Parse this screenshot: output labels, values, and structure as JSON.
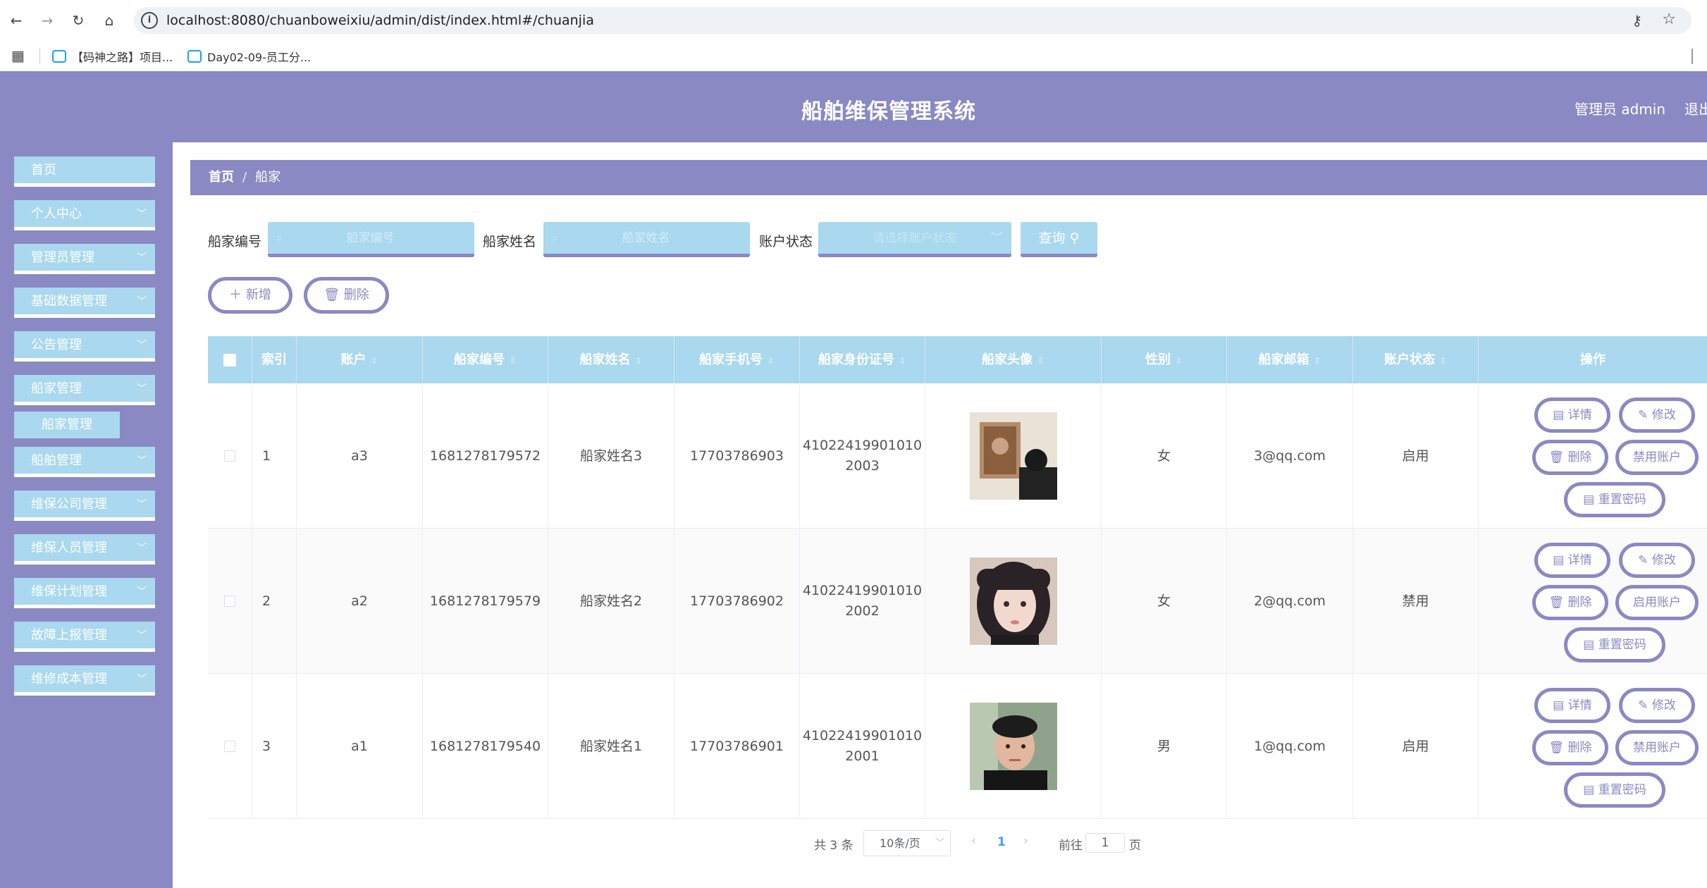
{
  "browser": {
    "url": "localhost:8080/chuanboweixiu/admin/dist/index.html#/chuanjia",
    "bookmarks": [
      "【码神之路】项目...",
      "Day02-09-员工分..."
    ]
  },
  "header": {
    "title": "船舶维保管理系统",
    "user": "管理员 admin",
    "logout": "退出"
  },
  "sidebar": {
    "items": [
      {
        "label": "首页"
      },
      {
        "label": "个人中心"
      },
      {
        "label": "管理员管理"
      },
      {
        "label": "基础数据管理"
      },
      {
        "label": "公告管理"
      },
      {
        "label": "船家管理"
      },
      {
        "label": "船舶管理"
      },
      {
        "label": "维保公司管理"
      },
      {
        "label": "维保人员管理"
      },
      {
        "label": "维保计划管理"
      },
      {
        "label": "故障上报管理"
      },
      {
        "label": "维修成本管理"
      }
    ],
    "sub_item": "船家管理"
  },
  "breadcrumb": {
    "home": "首页",
    "current": "船家"
  },
  "search": {
    "field1_label": "船家编号",
    "field1_placeholder": "船家编号",
    "field2_label": "船家姓名",
    "field2_placeholder": "船家姓名",
    "field3_label": "账户状态",
    "field3_placeholder": "请选择账户状态",
    "query": "查询"
  },
  "actions": {
    "add": "新增",
    "delete": "删除"
  },
  "table": {
    "headers": [
      "索引",
      "账户",
      "船家编号",
      "船家姓名",
      "船家手机号",
      "船家身份证号",
      "船家头像",
      "性别",
      "船家邮箱",
      "账户状态",
      "操作"
    ],
    "rows": [
      {
        "index": "1",
        "account": "a3",
        "code": "1681278179572",
        "name": "船家姓名3",
        "phone": "17703786903",
        "id_line1": "41022419901010",
        "id_line2": "2003",
        "gender": "女",
        "email": "3@qq.com",
        "status": "启用",
        "toggle": "禁用账户"
      },
      {
        "index": "2",
        "account": "a2",
        "code": "1681278179579",
        "name": "船家姓名2",
        "phone": "17703786902",
        "id_line1": "41022419901010",
        "id_line2": "2002",
        "gender": "女",
        "email": "2@qq.com",
        "status": "禁用",
        "toggle": "启用账户"
      },
      {
        "index": "3",
        "account": "a1",
        "code": "1681278179540",
        "name": "船家姓名1",
        "phone": "17703786901",
        "id_line1": "41022419901010",
        "id_line2": "2001",
        "gender": "男",
        "email": "1@qq.com",
        "status": "启用",
        "toggle": "禁用账户"
      }
    ],
    "op_labels": {
      "detail": "详情",
      "edit": "修改",
      "delete": "删除",
      "reset": "重置密码"
    }
  },
  "pagination": {
    "total": "共 3 条",
    "page_size": "10条/页",
    "current": "1",
    "goto": "前往",
    "goto_value": "1",
    "page_suffix": "页"
  },
  "colors": {
    "primary": "#8a89c3",
    "accent": "#a9d8ef"
  }
}
